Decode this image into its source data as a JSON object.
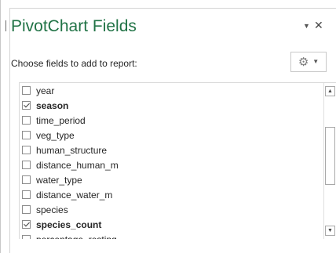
{
  "pane": {
    "title": "PivotChart Fields",
    "menu_icon": "chevron-down-icon",
    "close_icon": "close-icon",
    "instruction": "Choose fields to add to report:",
    "tools_icon": "gear-icon"
  },
  "fields": [
    {
      "label": "year",
      "checked": false
    },
    {
      "label": "season",
      "checked": true
    },
    {
      "label": "time_period",
      "checked": false
    },
    {
      "label": "veg_type",
      "checked": false
    },
    {
      "label": "human_structure",
      "checked": false
    },
    {
      "label": "distance_human_m",
      "checked": false
    },
    {
      "label": "water_type",
      "checked": false
    },
    {
      "label": "distance_water_m",
      "checked": false
    },
    {
      "label": "species",
      "checked": false
    },
    {
      "label": "species_count",
      "checked": true
    },
    {
      "label": "percentage_resting",
      "checked": false
    }
  ],
  "colors": {
    "title": "#217346",
    "text": "#262626",
    "border": "#d4d4d4"
  }
}
